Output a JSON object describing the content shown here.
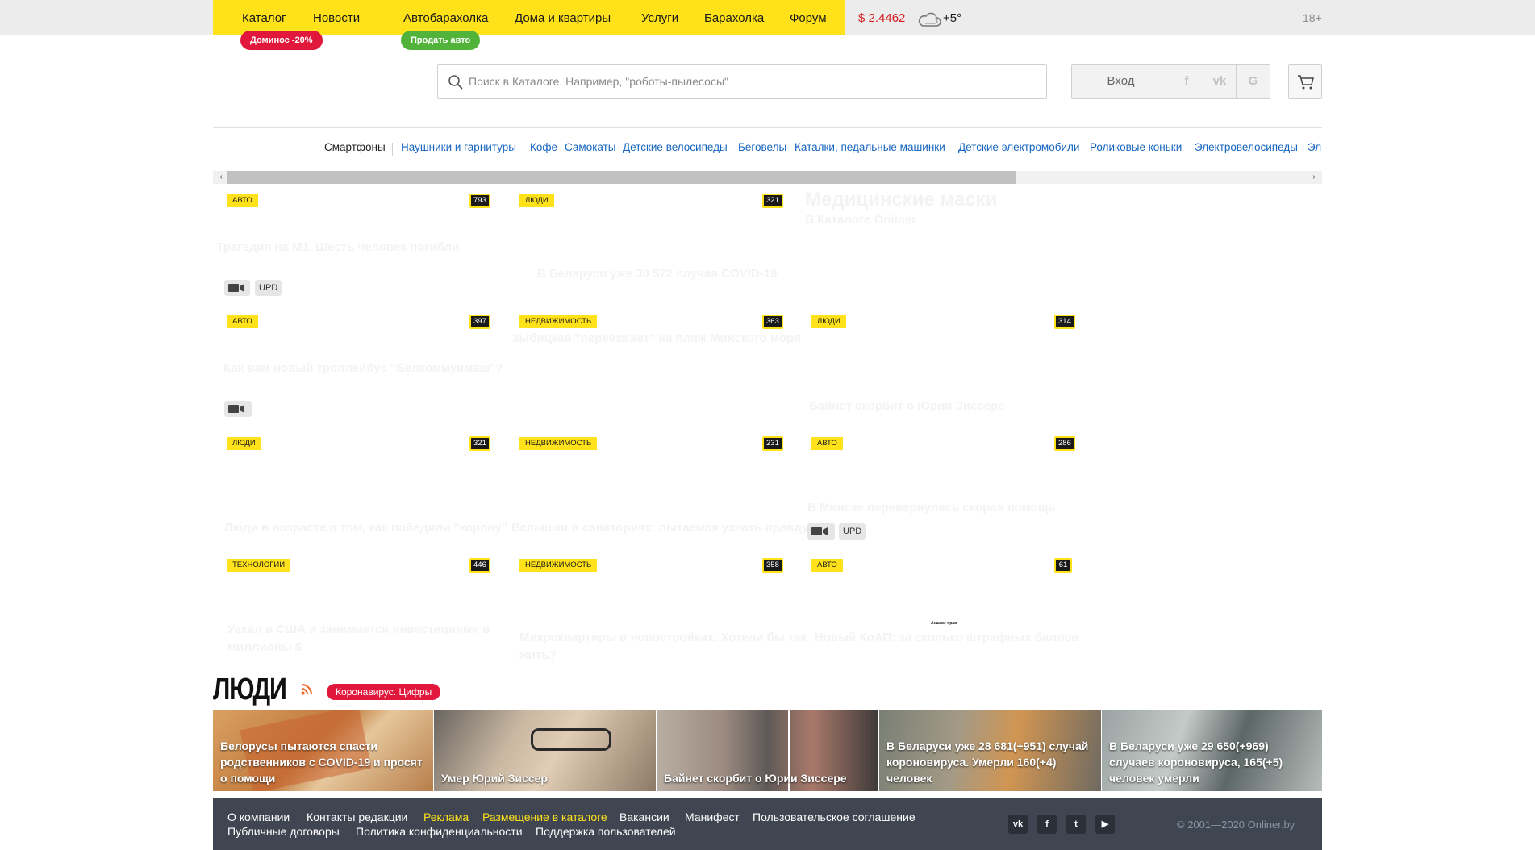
{
  "header": {
    "nav": [
      {
        "label": "Каталог"
      },
      {
        "label": "Новости"
      },
      {
        "label": "Автобарахолка"
      },
      {
        "label": "Дома и квартиры"
      },
      {
        "label": "Услуги"
      },
      {
        "label": "Барахолка"
      },
      {
        "label": "Форум"
      }
    ],
    "badges": {
      "catalog_promo": "Доминос -20%",
      "auto_promo": "Продать авто"
    },
    "currency": "$ 2.4462",
    "temperature": "+5°",
    "age_rating": "18+",
    "weather_icon": "cloud-icon"
  },
  "search": {
    "placeholder": "Поиск в Каталоге. Например, \"роботы-пылесосы\""
  },
  "account": {
    "login_label": "Вход",
    "social": [
      "f",
      "vk",
      "G"
    ]
  },
  "categories": {
    "items": [
      "Смартфоны",
      "Наушники и гарнитуры",
      "Кофе",
      "Самокаты",
      "Детские велосипеды",
      "Беговелы",
      "Каталки, педальные машинки",
      "Детские электромобили",
      "Роликовые коньки",
      "Электровелосипеды",
      "Эл"
    ],
    "left_arrow": "‹",
    "right_arrow": "›"
  },
  "news": {
    "row1": [
      {
        "tag": "АВТО",
        "count": "793",
        "title": "Трагедия на М1. Шесть человек погибли"
      },
      {
        "tag": "ЛЮДИ",
        "count": "321",
        "title": "В Беларуси уже 30 572 случая COVID-19"
      }
    ],
    "promo": {
      "title": "Медицинские маски",
      "subtitle": "В Каталоге Onliner"
    },
    "row1_badges": {
      "upd": "UPD"
    },
    "row2": [
      {
        "tag": "АВТО",
        "count": "397",
        "title": "Как вам новый троллейбус \"Белкоммунмаш\"?"
      },
      {
        "tag": "НЕДВИЖИМОСТЬ",
        "count": "363",
        "title": "Зыбицкая \"переезжает\" на пляж Минского моря"
      },
      {
        "tag": "ЛЮДИ",
        "count": "314",
        "title": "Байнет скорбит о Юрии Зиссере"
      }
    ],
    "row3": [
      {
        "tag": "ЛЮДИ",
        "count": "321",
        "title": "Люди в возрасте о том, как победили \"корону\""
      },
      {
        "tag": "НЕДВИЖИМОСТЬ",
        "count": "231",
        "title": "Вспышки в санаториях: пытаемся узнать правду"
      },
      {
        "tag": "АВТО",
        "count": "286",
        "title": "В Минске перевернулась скорая помощь",
        "upd": "UPD"
      }
    ],
    "row4": [
      {
        "tag": "ТЕХНОЛОГИИ",
        "count": "446",
        "title1": "Уехал в США и занимается инвестициями в",
        "title2": "миллионы $"
      },
      {
        "tag": "НЕДВИЖИМОСТЬ",
        "count": "358",
        "title1": "Микроквартиры в новостройках. Хотели бы так",
        "title2": "жить?"
      },
      {
        "tag": "АВТО",
        "count": "61",
        "title": "Новый КоАП: за сколько штрафных баллов",
        "tiny": "Аншлаг прав"
      }
    ]
  },
  "people": {
    "title": "ЛЮДИ",
    "badge": "Коронавирус. Цифры",
    "cards": [
      {
        "text": "Белорусы пытаются спасти родственников с COVID-19 и просят о помощи",
        "bg": "#c98a4f"
      },
      {
        "text": "Умер Юрий Зиссер",
        "bg": "#9d8670"
      },
      {
        "text": "Байнет скорбит о Юрии Зиссере",
        "bg": "#7a6b60"
      },
      {
        "text": "В Беларуси уже 28 681(+951) случай короновируса. Умерли 160(+4) человек",
        "bg": "#8b8675"
      },
      {
        "text": "В Беларуси уже 29 650(+969) случаев короновируса, 165(+5) человек умерли",
        "bg": "#7d8684"
      }
    ]
  },
  "footer": {
    "links_row1": [
      {
        "label": "О компании",
        "highlight": false
      },
      {
        "label": "Контакты редакции",
        "highlight": false
      },
      {
        "label": "Реклама",
        "highlight": true
      },
      {
        "label": "Размещение в каталоге",
        "highlight": true
      },
      {
        "label": "Вакансии",
        "highlight": false
      },
      {
        "label": "Манифест",
        "highlight": false
      },
      {
        "label": "Пользовательское соглашение",
        "highlight": false
      }
    ],
    "links_row2": [
      "Публичные договоры",
      "Политика конфиденциальности",
      "Поддержка пользователей"
    ],
    "social": [
      "vk",
      "f",
      "t",
      "▶"
    ],
    "copyright": "© 2001—2020 Onliner.by"
  },
  "colors": {
    "brand_yellow": "#ffe21a",
    "link_blue": "#1565c0",
    "promo_red": "#e1173c",
    "promo_green": "#52b33b",
    "footer_bg": "#3f4551"
  }
}
